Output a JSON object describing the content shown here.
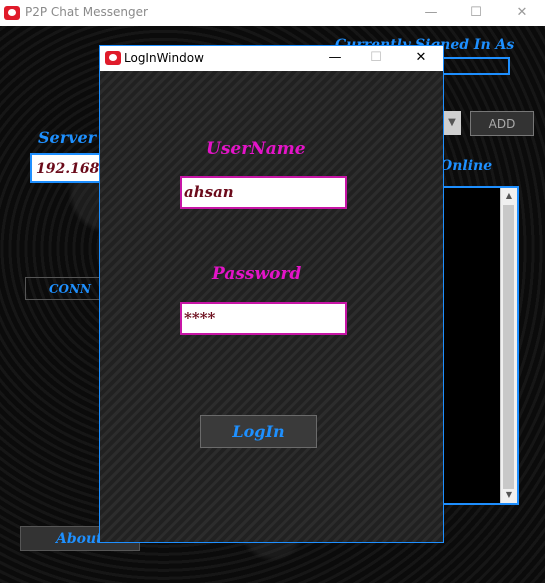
{
  "main_window": {
    "title": "P2P Chat Messenger",
    "controls": {
      "minimize": "—",
      "maximize": "☐",
      "close": "✕"
    },
    "server_label": "Server",
    "server_value": "192.168.",
    "connect_label": "CONN",
    "signed_in_label": "Currently Signed In As",
    "add_label": "ADD",
    "online_label": "Online",
    "about_label": "About"
  },
  "login_window": {
    "title": "LogInWindow",
    "controls": {
      "minimize": "—",
      "maximize": "☐",
      "close": "✕"
    },
    "username_label": "UserName",
    "username_value": "ahsan",
    "password_label": "Password",
    "password_value": "****",
    "login_button": "LogIn"
  },
  "colors": {
    "accent_blue": "#1e90ff",
    "pink_label": "#e414c8",
    "input_text": "#6b0a1a"
  }
}
